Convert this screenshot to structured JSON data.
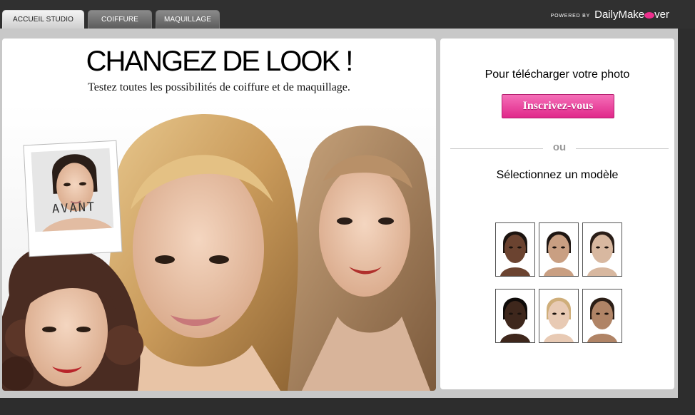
{
  "tabs": [
    {
      "label": "ACCUEIL STUDIO",
      "active": true
    },
    {
      "label": "COIFFURE",
      "active": false
    },
    {
      "label": "MAQUILLAGE",
      "active": false
    }
  ],
  "branding": {
    "powered_by": "POWERED BY",
    "brand_prefix": "DailyMake",
    "brand_suffix": "ver",
    "accent": "#ec2f8c"
  },
  "hero": {
    "headline": "CHANGEZ DE LOOK !",
    "subline": "Testez toutes les possibilités de coiffure et de maquillage.",
    "before_label": "AVANT"
  },
  "upload": {
    "title": "Pour télécharger votre photo",
    "signup_label": "Inscrivez-vous",
    "separator": "ou",
    "select_title": "Sélectionnez un modèle"
  },
  "models": [
    {
      "skin": "#6b4330",
      "hair": "#1c1410"
    },
    {
      "skin": "#c99f82",
      "hair": "#1e1612"
    },
    {
      "skin": "#d8b8a0",
      "hair": "#2a1e18"
    },
    {
      "skin": "#3e271c",
      "hair": "#0f0b09"
    },
    {
      "skin": "#e8cab4",
      "hair": "#cfae7a"
    },
    {
      "skin": "#b08466",
      "hair": "#2b1e16"
    }
  ]
}
